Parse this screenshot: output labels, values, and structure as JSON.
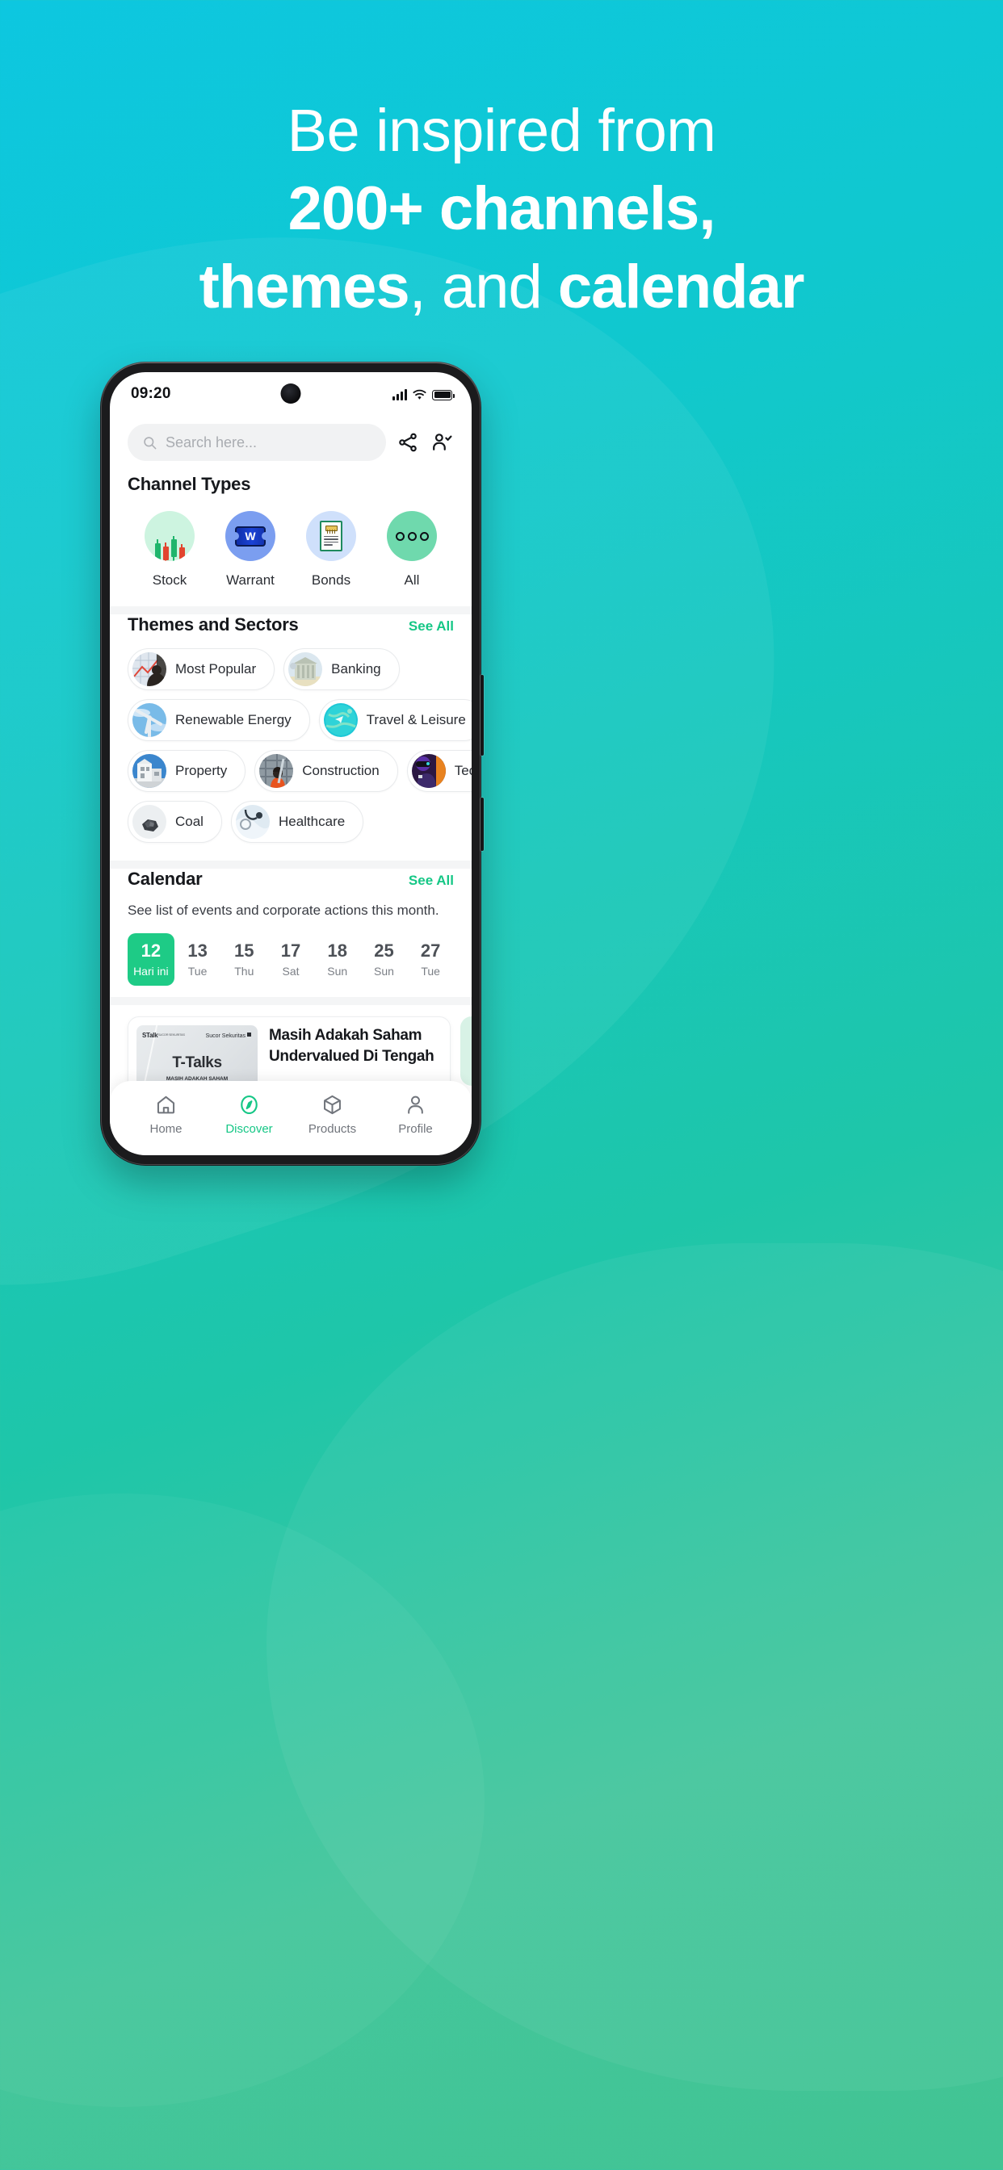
{
  "promo": {
    "line1": "Be inspired from",
    "line2": "200+ channels,",
    "line3_bold1": "themes",
    "line3_mid": ", and ",
    "line3_bold2": "calendar"
  },
  "colors": {
    "accent_green": "#16c786",
    "selected_date": "#1ecb86",
    "bg_top": "#0dc7e0",
    "bg_bottom": "#41c493"
  },
  "phone": {
    "status": {
      "clock": "09:20",
      "signal_icon": "signal-bars-icon",
      "wifi_icon": "wifi-icon",
      "battery_icon": "battery-full-icon"
    },
    "search": {
      "placeholder": "Search here...",
      "search_icon": "search-icon",
      "share_icon": "share-icon",
      "add_friend_icon": "user-check-icon"
    },
    "channel_types": {
      "title": "Channel Types",
      "items": [
        {
          "label": "Stock",
          "icon": "candlestick-chart-icon"
        },
        {
          "label": "Warrant",
          "icon": "warrant-ticket-icon"
        },
        {
          "label": "Bonds",
          "icon": "bond-certificate-icon"
        },
        {
          "label": "All",
          "icon": "three-dots-icon"
        }
      ]
    },
    "themes": {
      "title": "Themes and Sectors",
      "see_all": "See All",
      "items": [
        {
          "label": "Most Popular",
          "avatar": "chart-silhouette-avatar"
        },
        {
          "label": "Banking",
          "avatar": "bank-building-avatar"
        },
        {
          "label": "Renewable Energy",
          "avatar": "wind-turbine-avatar"
        },
        {
          "label": "Travel & Leisure",
          "avatar": "globe-travel-avatar"
        },
        {
          "label": "Property",
          "avatar": "modern-house-avatar"
        },
        {
          "label": "Construction",
          "avatar": "construction-worker-avatar"
        },
        {
          "label": "Tech Giants",
          "avatar": "vr-tech-avatar"
        },
        {
          "label": "Coal",
          "avatar": "coal-rock-avatar"
        },
        {
          "label": "Healthcare",
          "avatar": "stethoscope-avatar"
        }
      ]
    },
    "calendar": {
      "title": "Calendar",
      "see_all": "See All",
      "description": "See list of events and corporate actions this month.",
      "dates": [
        {
          "day": "12",
          "dow": "Hari ini",
          "selected": true
        },
        {
          "day": "13",
          "dow": "Tue",
          "selected": false
        },
        {
          "day": "15",
          "dow": "Thu",
          "selected": false
        },
        {
          "day": "17",
          "dow": "Sat",
          "selected": false
        },
        {
          "day": "18",
          "dow": "Sun",
          "selected": false
        },
        {
          "day": "25",
          "dow": "Sun",
          "selected": false
        },
        {
          "day": "27",
          "dow": "Tue",
          "selected": false
        }
      ],
      "event": {
        "title": "Masih Adakah Saham Undervalued Di Tengah",
        "thumb_brand": "STalk",
        "thumb_brand_sub": "SUCOR SEKURITAS",
        "thumb_partner": "Sucor Sekuritas",
        "thumb_title": "T-Talks",
        "thumb_sub": "MASIH ADAKAH SAHAM UNDERVALUED DI TENGAH REKOR ALL TIME HIGH IHSG?"
      }
    },
    "bottom_nav": [
      {
        "label": "Home",
        "icon": "home-icon",
        "active": false
      },
      {
        "label": "Discover",
        "icon": "compass-icon",
        "active": true
      },
      {
        "label": "Products",
        "icon": "cube-icon",
        "active": false
      },
      {
        "label": "Profile",
        "icon": "person-icon",
        "active": false
      }
    ]
  }
}
